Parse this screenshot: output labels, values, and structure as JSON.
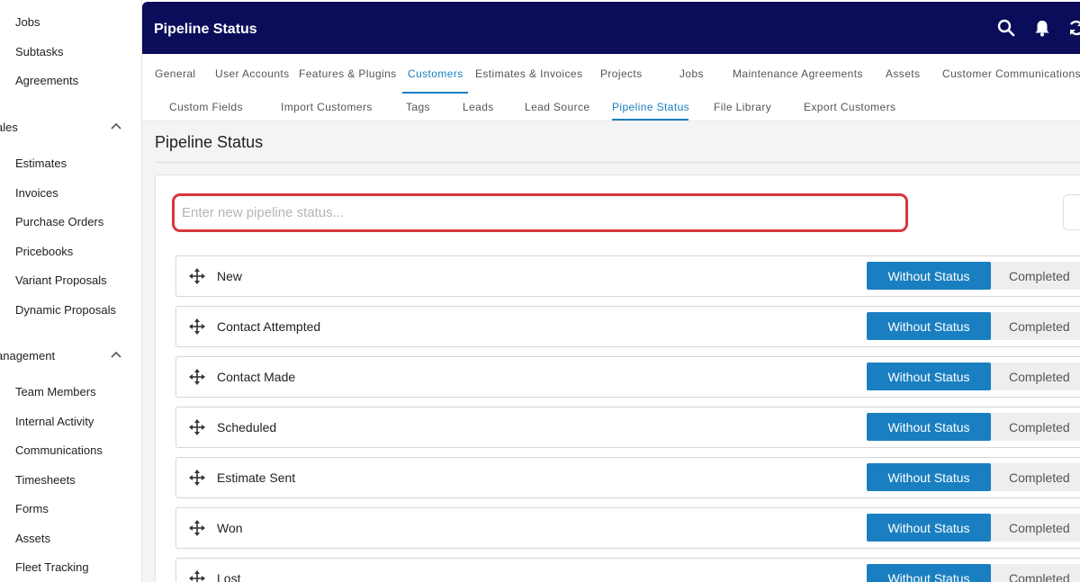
{
  "sidebar": {
    "items_top": [
      "Jobs",
      "Subtasks",
      "Agreements"
    ],
    "sales_header": "ales",
    "sales_items": [
      "Estimates",
      "Invoices",
      "Purchase Orders",
      "Pricebooks",
      "Variant Proposals",
      "Dynamic Proposals"
    ],
    "management_header": "anagement",
    "management_items": [
      "Team Members",
      "Internal Activity",
      "Communications",
      "Timesheets",
      "Forms",
      "Assets",
      "Fleet Tracking"
    ]
  },
  "header": {
    "title": "Pipeline Status",
    "icons": [
      "search-icon",
      "bell-icon",
      "refresh-icon"
    ]
  },
  "main_tabs": [
    "General",
    "User Accounts",
    "Features & Plugins",
    "Customers",
    "Estimates & Invoices",
    "Projects",
    "Jobs",
    "Maintenance Agreements",
    "Assets",
    "Customer Communications"
  ],
  "main_tabs_active": "Customers",
  "sub_tabs": [
    "Custom Fields",
    "Import Customers",
    "Tags",
    "Leads",
    "Lead Source",
    "Pipeline Status",
    "File Library",
    "Export Customers"
  ],
  "sub_tabs_active": "Pipeline Status",
  "page": {
    "title": "Pipeline Status",
    "input_placeholder": "Enter new pipeline status...",
    "input_value": ""
  },
  "statuses": [
    {
      "name": "New",
      "without_status_label": "Without Status",
      "completed_label": "Completed",
      "selected": "Without Status"
    },
    {
      "name": "Contact Attempted",
      "without_status_label": "Without Status",
      "completed_label": "Completed",
      "selected": "Without Status"
    },
    {
      "name": "Contact Made",
      "without_status_label": "Without Status",
      "completed_label": "Completed",
      "selected": "Without Status"
    },
    {
      "name": "Scheduled",
      "without_status_label": "Without Status",
      "completed_label": "Completed",
      "selected": "Without Status"
    },
    {
      "name": "Estimate Sent",
      "without_status_label": "Without Status",
      "completed_label": "Completed",
      "selected": "Without Status"
    },
    {
      "name": "Won",
      "without_status_label": "Without Status",
      "completed_label": "Completed",
      "selected": "Without Status"
    },
    {
      "name": "Lost",
      "without_status_label": "Without Status",
      "completed_label": "Completed",
      "selected": "Without Status"
    }
  ],
  "colors": {
    "header_bg": "#0b0d5a",
    "accent": "#1a7fc1",
    "input_border_highlight": "#d9363e",
    "content_bg": "#f3f4f6"
  }
}
